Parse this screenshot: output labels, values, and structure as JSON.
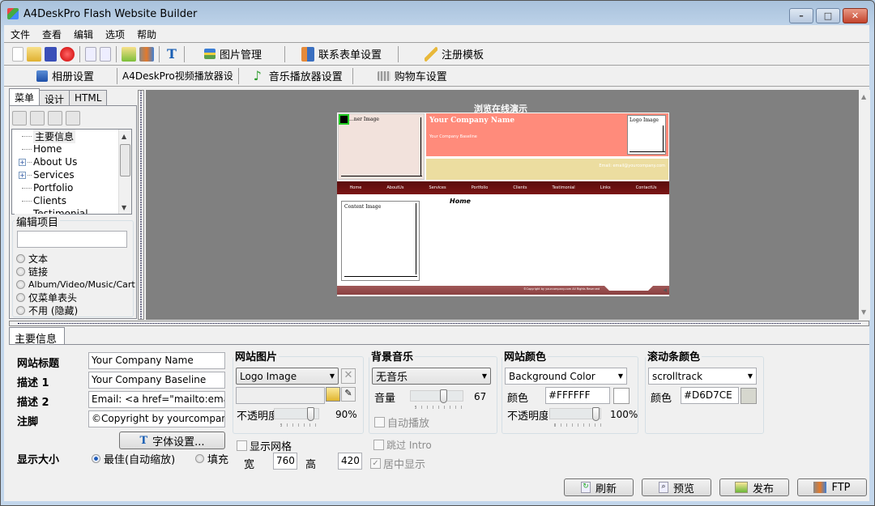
{
  "window": {
    "title": "A4DeskPro Flash Website Builder",
    "controls": {
      "minimize": "–",
      "maximize": "□",
      "close": "✕"
    }
  },
  "menu": [
    "文件",
    "查看",
    "编辑",
    "选项",
    "帮助"
  ],
  "toolbar1": {
    "icons": [
      "new-file-icon",
      "open-folder-icon",
      "save-icon",
      "close-red-icon",
      "refresh-icon",
      "preview-icon",
      "publish-icon",
      "ftp-icon",
      "font-t-icon"
    ],
    "image_manager": "图片管理",
    "contact_form": "联系表单设置",
    "register_template": "注册模板"
  },
  "toolbar2": {
    "album": "相册设置",
    "video_player": "A4DeskPro视频播放器设",
    "music_player": "音乐播放器设置",
    "shopping_cart": "购物车设置"
  },
  "left_panel": {
    "tabs": [
      "菜单",
      "设计",
      "HTML"
    ],
    "tree": [
      {
        "label": "主要信息",
        "expandable": false,
        "selected": true
      },
      {
        "label": "Home",
        "expandable": false
      },
      {
        "label": "About Us",
        "expandable": true
      },
      {
        "label": "Services",
        "expandable": true
      },
      {
        "label": "Portfolio",
        "expandable": false
      },
      {
        "label": "Clients",
        "expandable": false
      },
      {
        "label": "Testimonial",
        "expandable": false
      }
    ],
    "edit_group_label": "编辑项目",
    "edit_value": "",
    "radios": [
      "文本",
      "链接",
      "Album/Video/Music/Cart",
      "仅菜单表头",
      "不用 (隐藏)"
    ]
  },
  "preview": {
    "heading": "浏览在线演示",
    "banner_image_label": "...ner Image",
    "company_name": "Your Company Name",
    "company_baseline": "Your Company Baseline",
    "logo_image_label": "Logo Image",
    "email": "Email: email@yourcompany.com",
    "nav": [
      "Home",
      "AboutUs",
      "Services",
      "Portfolio",
      "Clients",
      "Testimonial",
      "Links",
      "ContactUs"
    ],
    "content_image_label": "Content Image",
    "page_title": "Home",
    "footer_copyright": "©Copyright by yourcompany.com All Rights Reserved",
    "colors": {
      "header_bg": "#FF8B7B",
      "sub_bg": "#ECDDA0",
      "nav_bg": "#6A1010",
      "banner_bg": "#F2E2DC"
    }
  },
  "bottom": {
    "tab": "主要信息",
    "fields": {
      "site_title_label": "网站标题",
      "site_title": "Your Company Name",
      "desc1_label": "描述 1",
      "desc1": "Your Company Baseline",
      "desc2_label": "描述 2",
      "desc2": "Email: <a href=\"mailto:email@yourc",
      "footer_label": "注脚",
      "footer": "©Copyright by yourcompany.com. .",
      "font_button": "字体设置...",
      "display_size_label": "显示大小",
      "display_best": "最佳(自动缩放)",
      "display_fill": "填充"
    },
    "site_image": {
      "group": "网站图片",
      "selected": "Logo Image",
      "path": "",
      "opacity_label": "不透明度",
      "opacity_value": "90%",
      "opacity_fraction": 0.9
    },
    "grid": {
      "show_grid": "显示网格",
      "checked": false,
      "width_label": "宽",
      "width": "760",
      "height_label": "高",
      "height": "420"
    },
    "music": {
      "group": "背景音乐",
      "selected": "无音乐",
      "volume_label": "音量",
      "volume_value": "67",
      "volume_fraction": 0.67,
      "autoplay": "自动播放",
      "skip_intro": "跳过 Intro",
      "center_display": "居中显示",
      "center_checked": true
    },
    "site_color": {
      "group": "网站颜色",
      "selected": "Background Color",
      "color_label": "颜色",
      "color_value": "#FFFFFF",
      "opacity_label": "不透明度",
      "opacity_value": "100%",
      "opacity_fraction": 1.0
    },
    "scrollbar_color": {
      "group": "滚动条颜色",
      "selected": "scrolltrack",
      "color_label": "颜色",
      "color_value": "#D6D7CE"
    }
  },
  "actions": {
    "refresh": "刷新",
    "preview": "预览",
    "publish": "发布",
    "ftp": "FTP"
  }
}
